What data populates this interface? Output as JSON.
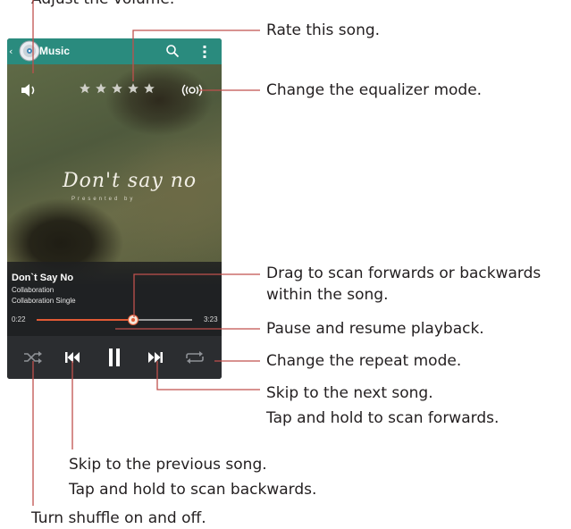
{
  "app": {
    "title": "Music",
    "album_title_art": "Don't say no",
    "album_subtitle_art": "Presented by"
  },
  "song": {
    "title": "Don`t Say No",
    "artist": "Collaboration",
    "album": "Collaboration Single",
    "current_time": "0:22",
    "total_time": "3:23",
    "progress_fraction": 0.62
  },
  "rating": {
    "stars": 0,
    "max_stars": 5
  },
  "colors": {
    "accent": "#2a8b7e",
    "seek": "#e05a35",
    "callout_line": "#c0504d"
  },
  "icons": {
    "back": "back-chevron-icon",
    "app": "music-disc-icon",
    "search": "search-icon",
    "menu": "overflow-menu-icon",
    "volume": "volume-icon",
    "equalizer": "equalizer-icon",
    "shuffle": "shuffle-icon",
    "previous": "previous-icon",
    "pause": "pause-icon",
    "next": "next-icon",
    "repeat": "repeat-icon"
  },
  "callouts": {
    "volume_top": "Adjust the volume.",
    "rate": "Rate this song.",
    "equalizer": "Change the equalizer mode.",
    "seek_1": "Drag to scan forwards or backwards",
    "seek_2": "within the song.",
    "pause": "Pause and resume playback.",
    "repeat": "Change the repeat mode.",
    "next_1": "Skip to the next song.",
    "next_2": "Tap and hold to scan forwards.",
    "prev_1": "Skip to the previous song.",
    "prev_2": "Tap and hold to scan backwards.",
    "shuffle": "Turn shuffle on and off."
  }
}
